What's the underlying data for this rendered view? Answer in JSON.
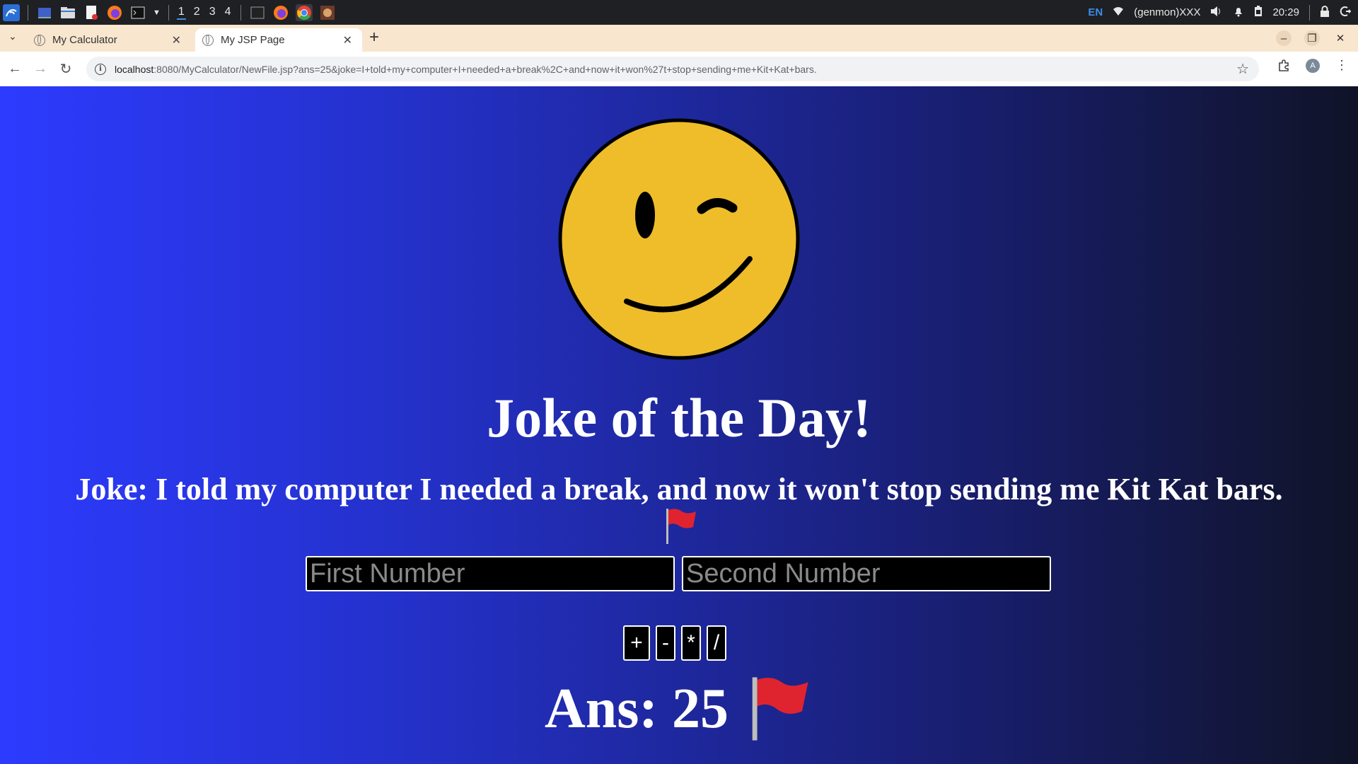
{
  "taskbar": {
    "workspaces": [
      "1",
      "2",
      "3",
      "4"
    ],
    "language": "EN",
    "user": "(genmon)XXX",
    "time": "20:29"
  },
  "browser": {
    "tabs": [
      {
        "label": "My Calculator",
        "active": false
      },
      {
        "label": "My JSP Page",
        "active": true
      }
    ],
    "url_host": "localhost",
    "url_path": ":8080/MyCalculator/NewFile.jsp?ans=25&joke=I+told+my+computer+I+needed+a+break%2C+and+now+it+won%27t+stop+sending+me+Kit+Kat+bars.",
    "avatar_letter": "A"
  },
  "page": {
    "title": "Joke of the Day!",
    "joke": "Joke: I told my computer I needed a break, and now it won't stop sending me Kit Kat bars.",
    "first_placeholder": "First Number",
    "second_placeholder": "Second Number",
    "operators": [
      "+",
      "-",
      "*",
      "/"
    ],
    "answer": "Ans: 25"
  },
  "colors": {
    "gradient_start": "#2d3bff",
    "gradient_end": "#101327",
    "smiley_fill": "#efbd2a",
    "flag_red": "#e0242f"
  }
}
